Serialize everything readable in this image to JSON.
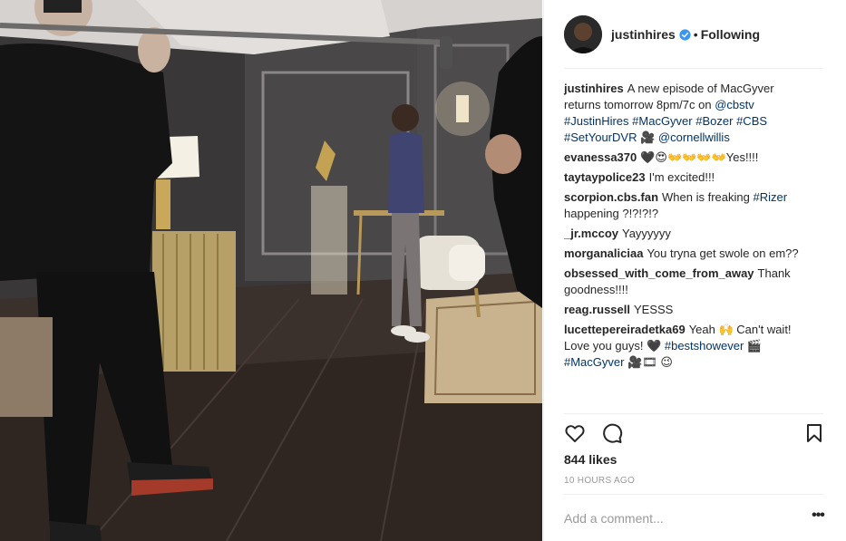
{
  "post": {
    "username": "justinhires",
    "follow_status": "Following",
    "separator": "•",
    "likes": "844 likes",
    "timestamp": "10 HOURS AGO",
    "add_comment_placeholder": "Add a comment...",
    "more_options": "•••"
  },
  "caption": {
    "user": "justinhires",
    "parts": [
      "A new episode of MacGyver returns tomorrow 8pm/7c on ",
      "@cbstv",
      " ",
      "#JustinHires",
      " ",
      "#MacGyver",
      " ",
      "#Bozer",
      " ",
      "#CBS",
      " ",
      "#SetYourDVR",
      " 🎥 ",
      "@cornellwillis"
    ]
  },
  "comments": [
    {
      "user": "evanessa370",
      "text": "🖤😍👐👐👐👐Yes!!!!"
    },
    {
      "user": "taytaypolice23",
      "text": "I'm excited!!!"
    },
    {
      "user": "scorpion.cbs.fan",
      "text": "When is freaking ",
      "tag": "#Rizer",
      "text2": " happening ?!?!?!?"
    },
    {
      "user": "_jr.mccoy",
      "text": "Yayyyyyy"
    },
    {
      "user": "morganaliciaa",
      "text": "You tryna get swole on em??"
    },
    {
      "user": "obsessed_with_come_from_away",
      "text": "Thank goodness!!!!"
    },
    {
      "user": "reag.russell",
      "text": "YESSS"
    },
    {
      "user": "lucettepereiradetka69",
      "text": "Yeah 🙌 Can't wait! Love you guys! 🖤 ",
      "tag": "#bestshowever",
      "text2": " 🎬 ",
      "tag2": "#MacGyver",
      "text3": " 🎥🎞 😉"
    }
  ],
  "icons": {
    "like": "heart-icon",
    "comment": "comment-icon",
    "save": "bookmark-icon",
    "verified": "verified-badge-icon"
  },
  "colors": {
    "link": "#003569",
    "verified": "#3897f0",
    "muted": "#999999",
    "text": "#262626"
  }
}
